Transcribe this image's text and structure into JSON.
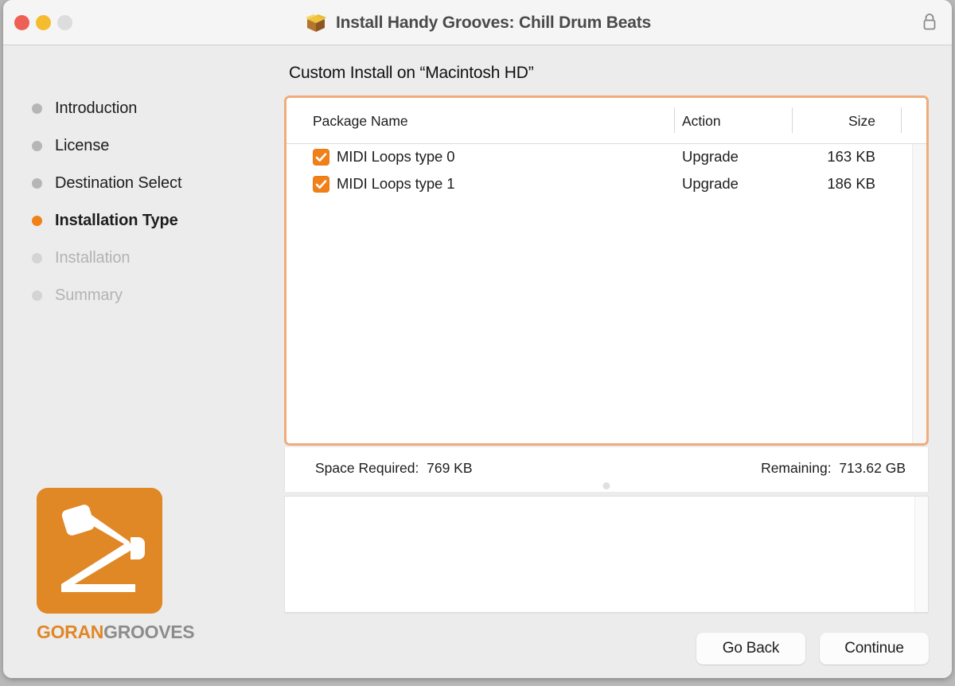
{
  "window": {
    "title": "Install Handy Grooves: Chill Drum Beats",
    "app_icon": "package-icon",
    "lock_icon": "lock-icon",
    "traffic_lights": [
      {
        "name": "close",
        "color": "#ee5f56"
      },
      {
        "name": "minimize",
        "color": "#f5bc2e"
      },
      {
        "name": "zoom",
        "color": "#dddddd"
      }
    ]
  },
  "sidebar": {
    "steps": [
      {
        "label": "Introduction",
        "state": "done"
      },
      {
        "label": "License",
        "state": "done"
      },
      {
        "label": "Destination Select",
        "state": "done"
      },
      {
        "label": "Installation Type",
        "state": "current"
      },
      {
        "label": "Installation",
        "state": "future"
      },
      {
        "label": "Summary",
        "state": "future"
      }
    ],
    "logo": {
      "name": "gorangrooves-logo",
      "word_primary": "GORAN",
      "word_secondary": "GROOVES",
      "brand_color": "#e08726"
    }
  },
  "main": {
    "heading": "Custom Install on “Macintosh HD”",
    "table": {
      "columns": [
        "Package Name",
        "Action",
        "Size"
      ],
      "rows": [
        {
          "checked": true,
          "name": "MIDI Loops type 0",
          "action": "Upgrade",
          "size": "163 KB"
        },
        {
          "checked": true,
          "name": "MIDI Loops type 1",
          "action": "Upgrade",
          "size": "186 KB"
        }
      ],
      "focus_ring_color": "#f0ab7a",
      "checkbox_color": "#f28019"
    },
    "space": {
      "required_label": "Space Required:",
      "required_value": "769 KB",
      "remaining_label": "Remaining:",
      "remaining_value": "713.62 GB"
    },
    "description": ""
  },
  "footer": {
    "go_back_label": "Go Back",
    "continue_label": "Continue"
  }
}
